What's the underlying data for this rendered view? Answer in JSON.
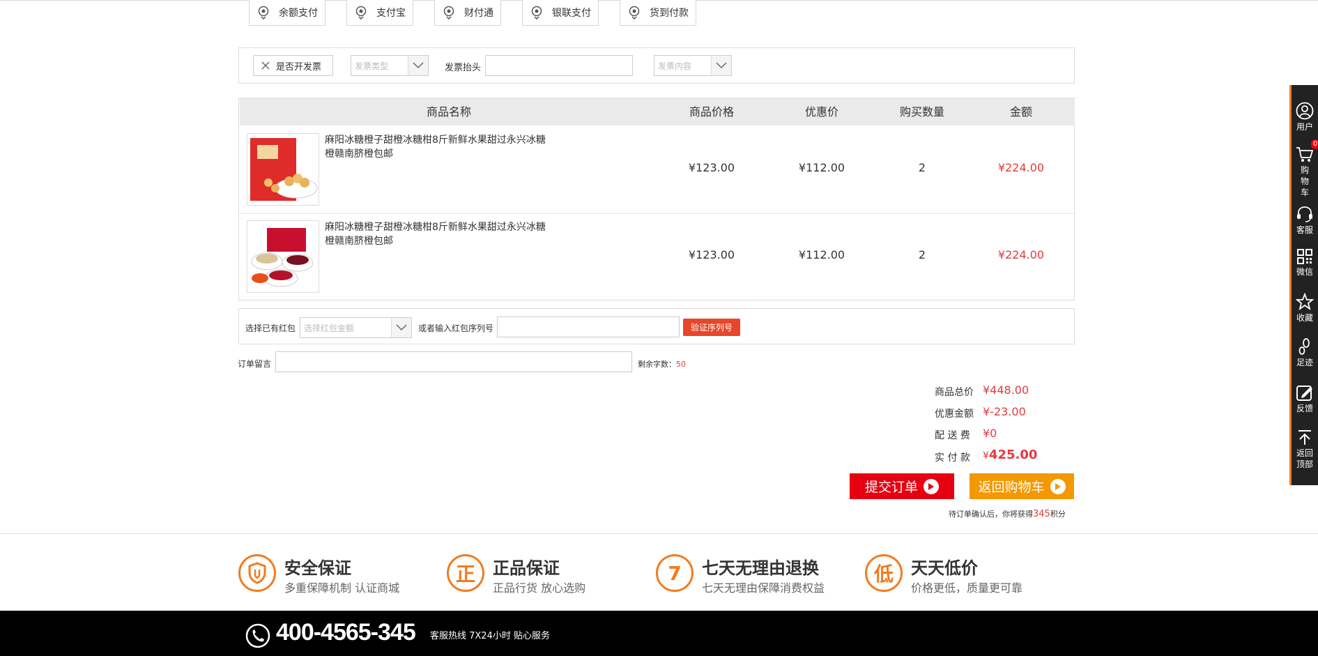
{
  "payments": [
    "余额支付",
    "支付宝",
    "财付通",
    "银联支付",
    "货到付款"
  ],
  "invoice": {
    "toggle_label": "是否开发票",
    "type_placeholder": "发票类型",
    "header_label": "发票抬头",
    "content_placeholder": "发票内容"
  },
  "table": {
    "headers": [
      "商品名称",
      "商品价格",
      "优惠价",
      "购买数量",
      "金额"
    ],
    "rows": [
      {
        "name": "麻阳冰糖橙子甜橙冰糖柑8斤新鲜水果甜过永兴冰糖橙赣南脐橙包邮",
        "price": "¥123.00",
        "discount": "¥112.00",
        "qty": "2",
        "amount": "¥224.00"
      },
      {
        "name": "麻阳冰糖橙子甜橙冰糖柑8斤新鲜水果甜过永兴冰糖橙赣南脐橙包邮",
        "price": "¥123.00",
        "discount": "¥112.00",
        "qty": "2",
        "amount": "¥224.00"
      }
    ]
  },
  "coupon": {
    "select_label": "选择已有红包",
    "select_placeholder": "选择红包金额",
    "or_label": "或者输入红包序列号",
    "verify_label": "验证序列号"
  },
  "note": {
    "label": "订单留言",
    "remain_label": "剩余字数：",
    "remain_value": "50"
  },
  "summary": {
    "total_label": "商品总价",
    "total_value": "¥448.00",
    "discount_label": "优惠金额",
    "discount_value": "¥-23.00",
    "shipping_label": "配 送 费",
    "shipping_value": "¥0",
    "pay_label": "实 付 款",
    "pay_currency": "¥",
    "pay_value": "425.00"
  },
  "actions": {
    "submit_label": "提交订单",
    "back_label": "返回购物车",
    "points_prefix": "待订单确认后，你将获得",
    "points_value": "345",
    "points_suffix": "积分"
  },
  "guarantees": [
    {
      "badge": "盾",
      "title": "安全保证",
      "sub": "多重保障机制 认证商城"
    },
    {
      "badge": "正",
      "title": "正品保证",
      "sub": "正品行货 放心选购"
    },
    {
      "badge": "7",
      "title": "七天无理由退换",
      "sub": "七天无理由保障消费权益"
    },
    {
      "badge": "低",
      "title": "天天低价",
      "sub": "价格更低，质量更可靠"
    }
  ],
  "footer": {
    "phone": "400-4565-345",
    "hotline": "客服热线 7X24小时 贴心服务"
  },
  "sidebar": {
    "user": "用户",
    "cart": "购物车",
    "cart_badge": "0",
    "service": "客服",
    "wechat": "微信",
    "favorite": "收藏",
    "history": "足迹",
    "feedback": "反馈",
    "top": "返回顶部"
  },
  "colors": {
    "accent": "#f27b1f",
    "price_red": "#e4393c",
    "submit_red": "#e60012",
    "back_orange": "#f39800"
  }
}
